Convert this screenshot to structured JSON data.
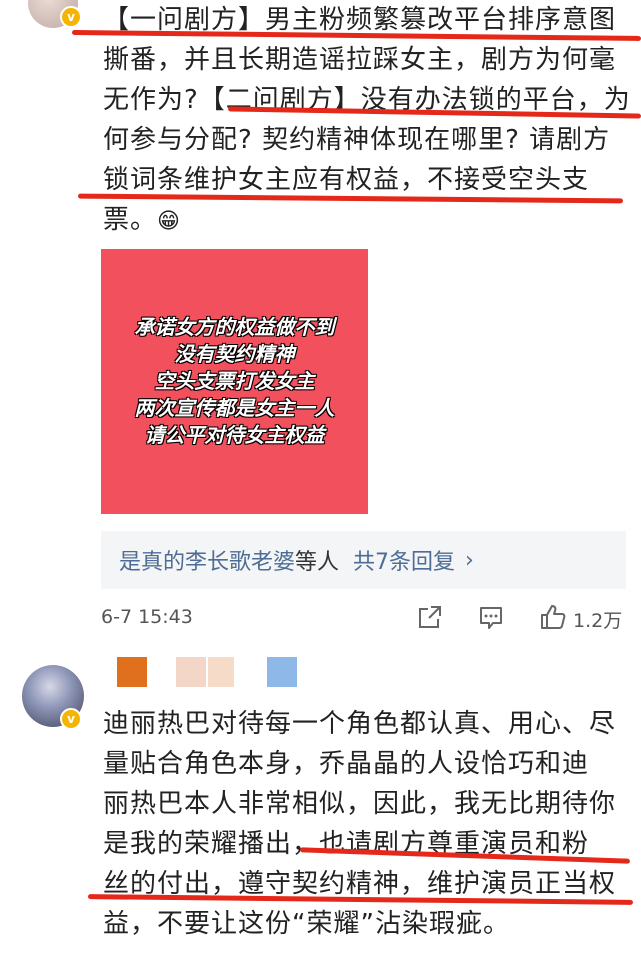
{
  "comment1": {
    "lines": [
      "【一问剧方】男主粉频繁篡改平台排序意图",
      "撕番，并且长期造谣拉踩女主，剧方为何毫",
      "无作为?【二问剧方】没有办法锁的平台，为",
      "何参与分配? 契约精神体现在哪里? 请剧方",
      "锁词条维护女主应有权益，不接受空头支",
      "票。"
    ],
    "emoji": "😁",
    "badge": "v",
    "poster_lines": [
      "承诺女方的权益做不到",
      "没有契约精神",
      "空头支票打发女主",
      "两次宣传都是女主一人",
      "请公平对待女主权益"
    ],
    "replies": {
      "name": "是真的李长歌老婆",
      "suffix": "等人",
      "count": "共7条回复",
      "chevron": "›"
    },
    "time": "6-7 15:43",
    "likes": "1.2万",
    "icons": [
      "share-icon",
      "comment-icon",
      "like-icon"
    ]
  },
  "comment2": {
    "badge": "v",
    "swatch_colors": [
      "#e0701e",
      "#f3d6c7",
      "#f6dcc8",
      "#8db8e8"
    ],
    "lines": [
      "迪丽热巴对待每一个角色都认真、用心、尽",
      "量贴合角色本身，乔晶晶的人设恰巧和迪",
      "丽热巴本人非常相似，因此，我无比期待你",
      "是我的荣耀播出，也请剧方尊重演员和粉",
      "丝的付出，遵守契约精神，维护演员正当权",
      "益，不要让这份“荣耀”沾染瑕疵。"
    ]
  },
  "colors": {
    "underline": "#e4291b",
    "poster_bg": "#f1505c",
    "link_blue": "#4e6d94",
    "badge_gold": "#f5b400"
  }
}
